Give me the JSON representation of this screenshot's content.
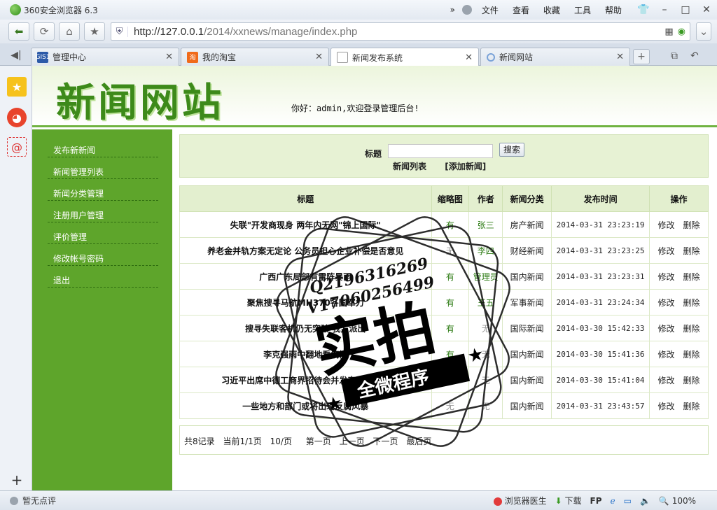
{
  "browser": {
    "app_title": "360安全浏览器 6.3",
    "menu": [
      "文件",
      "查看",
      "收藏",
      "工具",
      "帮助"
    ],
    "url_host": "http://127.0.0.1",
    "url_path": "/2014/xxnews/manage/index.php"
  },
  "tabs": [
    {
      "label": "管理中心",
      "icon": "site-favicon-icon",
      "icon_text": "GIS1",
      "active": false
    },
    {
      "label": "我的淘宝",
      "icon": "taobao-icon",
      "icon_text": "淘",
      "active": false
    },
    {
      "label": "新闻发布系统",
      "icon": "page-icon",
      "icon_text": "",
      "active": true
    },
    {
      "label": "新闻网站",
      "icon": "loading-icon",
      "icon_text": "",
      "active": false
    }
  ],
  "site": {
    "title": "新闻网站",
    "welcome": "你好：admin,欢迎登录管理后台!"
  },
  "sidebar": {
    "items": [
      {
        "label": "发布新新闻"
      },
      {
        "label": "新闻管理列表"
      },
      {
        "label": "新闻分类管理"
      },
      {
        "label": "注册用户管理"
      },
      {
        "label": "评价管理"
      },
      {
        "label": "修改帐号密码"
      },
      {
        "label": "退出"
      }
    ]
  },
  "search": {
    "label": "标题",
    "value": "",
    "button": "搜索",
    "list_link": "新闻列表",
    "add_link": "[添加新闻]"
  },
  "table": {
    "headers": [
      "标题",
      "缩略图",
      "作者",
      "新闻分类",
      "发布时间",
      "操作"
    ],
    "rows": [
      {
        "title": "失联\"开发商现身 两年内无网\"锦上国际\"",
        "thumb": "有",
        "author": "张三",
        "category": "房产新闻",
        "time": "2014-03-31 23:23:19",
        "edit": "修改",
        "delete": "删除"
      },
      {
        "title": "养老金并轨方案无定论 公务员担心企业补偿是否意见",
        "thumb": "无",
        "author": "李四",
        "category": "财经新闻",
        "time": "2014-03-31 23:23:25",
        "edit": "修改",
        "delete": "删除"
      },
      {
        "title": "广西广东局部有雷阵暴雨",
        "thumb": "有",
        "author": "管理员",
        "category": "国内新闻",
        "time": "2014-03-31 23:23:31",
        "edit": "修改",
        "delete": "删除"
      },
      {
        "title": "聚焦搜寻马航MH370各国军力",
        "thumb": "有",
        "author": "王五",
        "category": "军事新闻",
        "time": "2014-03-31 23:24:34",
        "edit": "修改",
        "delete": "删除"
      },
      {
        "title": "搜寻失联客机仍无突破 我方派出",
        "thumb": "有",
        "author": "无",
        "category": "国际新闻",
        "time": "2014-03-30 15:42:33",
        "edit": "修改",
        "delete": "删除"
      },
      {
        "title": "李克强雨中翻地看墒情",
        "thumb": "有",
        "author": "无",
        "category": "国内新闻",
        "time": "2014-03-30 15:41:36",
        "edit": "修改",
        "delete": "删除"
      },
      {
        "title": "习近平出席中德工商界招待会并发表重要讲话",
        "thumb": "无",
        "author": "无",
        "category": "国内新闻",
        "time": "2014-03-30 15:41:04",
        "edit": "修改",
        "delete": "删除"
      },
      {
        "title": "一些地方和部门或将出现反腐风暴",
        "thumb": "无",
        "author": "无",
        "category": "国内新闻",
        "time": "2014-03-31 23:43:57",
        "edit": "修改",
        "delete": "删除"
      }
    ]
  },
  "pager": {
    "total": "共8记录",
    "current": "当前1/1页",
    "per_page": "10/页",
    "first": "第一页",
    "prev": "上一页",
    "next": "下一页",
    "last": "最后页"
  },
  "watermark": {
    "line1": "Q2196316269",
    "line2": "V17060256499",
    "main": "实拍",
    "sub": "全微程序"
  },
  "statusbar": {
    "left": "暂无点评",
    "doctor": "浏览器医生",
    "download": "下载",
    "zoom": "100%"
  },
  "colors": {
    "brand_green": "#5ea52b",
    "title_green": "#3d8a1a",
    "panel_green": "#e7f2d4"
  }
}
